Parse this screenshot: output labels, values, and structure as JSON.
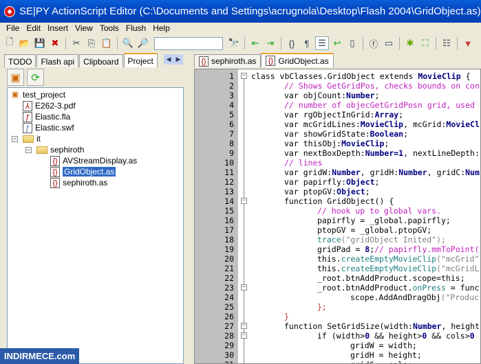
{
  "title": "SE|PY ActionScript Editor (C:\\Documents and Settings\\acrugnola\\Desktop\\Flash 2004\\GridObject.as)",
  "menu": [
    "File",
    "Edit",
    "Insert",
    "View",
    "Tools",
    "Flush",
    "Help"
  ],
  "find_value": "",
  "left_tabs": [
    "TODO",
    "Flash api",
    "Clipboard",
    "Project"
  ],
  "tree": {
    "root": "test_project",
    "files": [
      "E262-3.pdf",
      "Elastic.fla",
      "Elastic.swf"
    ],
    "folder": "it",
    "subfolder": "sephiroth",
    "subfiles": [
      "AVStreamDisplay.as",
      "GridObject.as",
      "sephiroth.as"
    ]
  },
  "editor_tabs": [
    "sephiroth.as",
    "GridObject.as"
  ],
  "code": [
    [
      [
        "",
        "class vbClasses.GridObject extends "
      ],
      [
        "t",
        "MovieClip"
      ],
      [
        "",
        " {"
      ]
    ],
    [
      [
        "",
        "\t"
      ],
      [
        "c",
        "// Shows GetGridPos, checks bounds on con"
      ]
    ],
    [
      [
        "",
        "\tvar objCount:"
      ],
      [
        "t",
        "Number"
      ],
      [
        "",
        ";"
      ]
    ],
    [
      [
        "",
        "\t"
      ],
      [
        "c",
        "// number of objecGetGridPosn grid, used"
      ]
    ],
    [
      [
        "",
        "\tvar rgObjectInGrid:"
      ],
      [
        "t",
        "Array"
      ],
      [
        "",
        ";"
      ]
    ],
    [
      [
        "",
        "\tvar mcGridLines:"
      ],
      [
        "t",
        "MovieClip"
      ],
      [
        "",
        ", mcGrid:"
      ],
      [
        "t",
        "MovieCl"
      ]
    ],
    [
      [
        "",
        "\tvar showGridState:"
      ],
      [
        "t",
        "Boolean"
      ],
      [
        "",
        ";"
      ]
    ],
    [
      [
        "",
        "\tvar thisObj:"
      ],
      [
        "t",
        "MovieClip"
      ],
      [
        "",
        ";"
      ]
    ],
    [
      [
        "",
        "\tvar nextBoxDepth:"
      ],
      [
        "t",
        "Number"
      ],
      [
        "n",
        "=1"
      ],
      [
        "",
        ", nextLineDepth:"
      ]
    ],
    [
      [
        "",
        "\t"
      ],
      [
        "c",
        "// lines"
      ]
    ],
    [
      [
        "",
        "\tvar gridW:"
      ],
      [
        "t",
        "Number"
      ],
      [
        "",
        ", gridH:"
      ],
      [
        "t",
        "Number"
      ],
      [
        "",
        ", gridC:"
      ],
      [
        "t",
        "Num"
      ]
    ],
    [
      [
        "",
        "\tvar papirfly:"
      ],
      [
        "t",
        "Object"
      ],
      [
        "",
        ";"
      ]
    ],
    [
      [
        "",
        "\tvar ptopGV:"
      ],
      [
        "t",
        "Object"
      ],
      [
        "",
        ";"
      ]
    ],
    [
      [
        "",
        "\tfunction GridObject() {"
      ]
    ],
    [
      [
        "",
        "\t\t"
      ],
      [
        "c",
        "// hook up to global vars."
      ]
    ],
    [
      [
        "",
        "\t\tpapirfly = _global.papirfly;"
      ]
    ],
    [
      [
        "",
        "\t\tptopGV = _global.ptopGV;"
      ]
    ],
    [
      [
        "",
        "\t\t"
      ],
      [
        "m",
        "trace"
      ],
      [
        "s",
        "(\"gridObject Inited\");"
      ]
    ],
    [
      [
        "",
        "\t\tgridPad = "
      ],
      [
        "n",
        "8"
      ],
      [
        "",
        ";"
      ],
      [
        "c",
        "// papirfly.mmToPoint("
      ]
    ],
    [
      [
        "",
        "\t\tthis."
      ],
      [
        "m",
        "createEmptyMovieClip"
      ],
      [
        "s",
        "(\"mcGrid\""
      ]
    ],
    [
      [
        "",
        "\t\tthis."
      ],
      [
        "m",
        "createEmptyMovieClip"
      ],
      [
        "s",
        "(\"mcGridL"
      ]
    ],
    [
      [
        "",
        "\t\t_root.btnAddProduct.scope=this;"
      ]
    ],
    [
      [
        "",
        "\t\t_root.btnAddProduct."
      ],
      [
        "m",
        "onPress"
      ],
      [
        "",
        " = func"
      ]
    ],
    [
      [
        "",
        "\t\t\tscope.AddAndDragObj"
      ],
      [
        "s",
        "(\"Produc"
      ]
    ],
    [
      [
        "",
        "\t\t"
      ],
      [
        "r",
        "};"
      ]
    ],
    [
      [
        "",
        "\t"
      ],
      [
        "r",
        "}"
      ]
    ],
    [
      [
        "",
        "\tfunction SetGridSize(width:"
      ],
      [
        "t",
        "Number"
      ],
      [
        "",
        ", height"
      ]
    ],
    [
      [
        "",
        "\t\tif (width>"
      ],
      [
        "n",
        "0"
      ],
      [
        "",
        " && height>"
      ],
      [
        "n",
        "0"
      ],
      [
        "",
        " && cols>"
      ],
      [
        "n",
        "0"
      ]
    ],
    [
      [
        "",
        "\t\t\tgridW = width;"
      ]
    ],
    [
      [
        "",
        "\t\t\tgridH = height;"
      ]
    ],
    [
      [
        "",
        "\t\t\tgridC = cols;"
      ]
    ]
  ],
  "fold_lines": [
    1,
    14,
    23,
    27,
    28
  ],
  "watermark": "INDIRMECE.com"
}
